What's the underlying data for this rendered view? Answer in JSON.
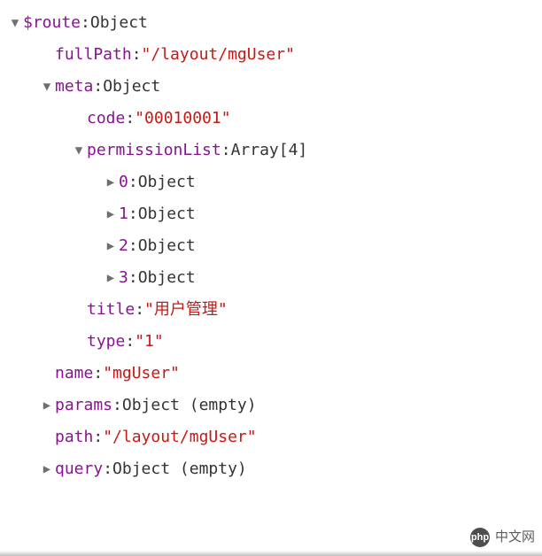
{
  "rows": [
    {
      "indent": 0,
      "arrow": "down",
      "key": "$route",
      "valueType": "type",
      "value": "Object"
    },
    {
      "indent": 1,
      "arrow": "none",
      "key": "fullPath",
      "valueType": "string",
      "value": "\"/layout/mgUser\""
    },
    {
      "indent": 1,
      "arrow": "down",
      "key": "meta",
      "valueType": "type",
      "value": "Object"
    },
    {
      "indent": 2,
      "arrow": "none",
      "key": "code",
      "valueType": "string",
      "value": "\"00010001\""
    },
    {
      "indent": 2,
      "arrow": "down",
      "key": "permissionList",
      "valueType": "type",
      "value": "Array[4]"
    },
    {
      "indent": 3,
      "arrow": "right",
      "key": "0",
      "valueType": "type",
      "value": "Object"
    },
    {
      "indent": 3,
      "arrow": "right",
      "key": "1",
      "valueType": "type",
      "value": "Object"
    },
    {
      "indent": 3,
      "arrow": "right",
      "key": "2",
      "valueType": "type",
      "value": "Object"
    },
    {
      "indent": 3,
      "arrow": "right",
      "key": "3",
      "valueType": "type",
      "value": "Object"
    },
    {
      "indent": 2,
      "arrow": "none",
      "key": "title",
      "valueType": "string",
      "value": "\"用户管理\""
    },
    {
      "indent": 2,
      "arrow": "none",
      "key": "type",
      "valueType": "string",
      "value": "\"1\""
    },
    {
      "indent": 1,
      "arrow": "none",
      "key": "name",
      "valueType": "string",
      "value": "\"mgUser\""
    },
    {
      "indent": 1,
      "arrow": "right",
      "key": "params",
      "valueType": "type",
      "value": "Object (empty)"
    },
    {
      "indent": 1,
      "arrow": "none",
      "key": "path",
      "valueType": "string",
      "value": "\"/layout/mgUser\""
    },
    {
      "indent": 1,
      "arrow": "right",
      "key": "query",
      "valueType": "type",
      "value": "Object (empty)"
    }
  ],
  "glyphs": {
    "down": "▼",
    "right": "▶",
    "none": "▶"
  },
  "colon": ":",
  "indentUnit": 36,
  "baseIndent": 4,
  "watermark": {
    "logo": "php",
    "text": "中文网"
  }
}
